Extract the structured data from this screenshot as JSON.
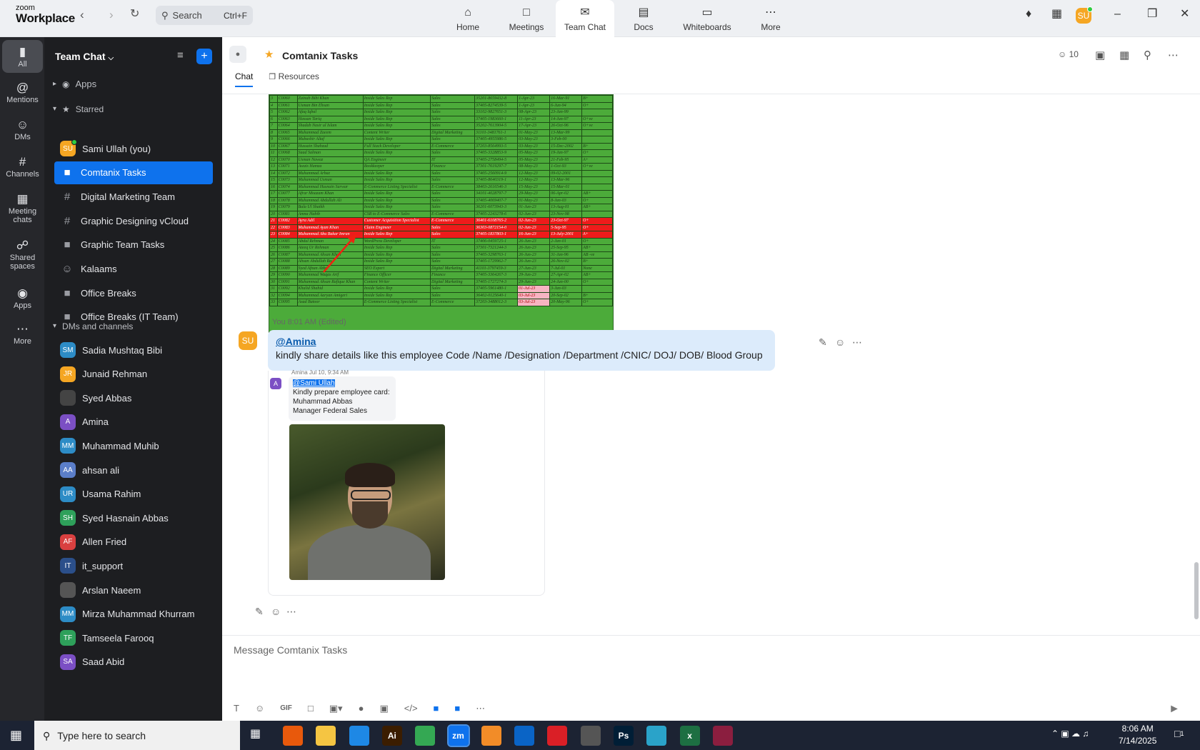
{
  "app": {
    "brand_small": "zoom",
    "brand": "Workplace",
    "search_placeholder": "Search",
    "search_shortcut": "Ctrl+F",
    "user_initials": "SU",
    "tabs": [
      {
        "label": "Home",
        "icon": "home-icon"
      },
      {
        "label": "Meetings",
        "icon": "video-icon"
      },
      {
        "label": "Team Chat",
        "icon": "chat-icon"
      },
      {
        "label": "Docs",
        "icon": "docs-icon"
      },
      {
        "label": "Whiteboards",
        "icon": "whiteboard-icon"
      },
      {
        "label": "More",
        "icon": "more-icon"
      }
    ]
  },
  "rail": [
    {
      "label": "All",
      "icon": "chat-bubble-icon"
    },
    {
      "label": "Mentions",
      "icon": "at-icon"
    },
    {
      "label": "DMs",
      "icon": "people-icon"
    },
    {
      "label": "Channels",
      "icon": "hash-icon"
    },
    {
      "label": "Meeting chats",
      "icon": "calendar-icon"
    },
    {
      "label": "Shared spaces",
      "icon": "shared-icon"
    },
    {
      "label": "Apps",
      "icon": "apps-icon"
    },
    {
      "label": "More",
      "icon": "more-icon"
    }
  ],
  "sidebar": {
    "title": "Team Chat",
    "apps_label": "Apps",
    "starred_label": "Starred",
    "dms_label": "DMs and channels",
    "starred": [
      {
        "name": "Sami Ullah (you)",
        "initials": "SU",
        "color": "#f5a623",
        "kind": "avatar",
        "status": "#2ecc40"
      },
      {
        "name": "Comtanix Tasks",
        "kind": "lock",
        "active": true
      },
      {
        "name": "Digital Marketing Team",
        "kind": "hash"
      },
      {
        "name": "Graphic Designing vCloud",
        "kind": "hash"
      },
      {
        "name": "Graphic Team Tasks",
        "kind": "lock"
      },
      {
        "name": "Kalaams",
        "kind": "group"
      },
      {
        "name": "Office Breaks",
        "kind": "lock"
      },
      {
        "name": "Office Breaks (IT Team)",
        "kind": "lock"
      }
    ],
    "dms": [
      {
        "name": "Sadia Mushtaq Bibi",
        "initials": "SM",
        "color": "#2d8cc6",
        "status": "#2ecc40"
      },
      {
        "name": "Junaid Rehman",
        "initials": "JR",
        "color": "#f5a623",
        "status": "#2ecc40"
      },
      {
        "name": "Syed Abbas",
        "initials": "",
        "color": "#444",
        "status": "#2ecc40"
      },
      {
        "name": "Amina",
        "initials": "A",
        "color": "#7b4fc4",
        "status": "#999"
      },
      {
        "name": "Muhammad Muhib",
        "initials": "MM",
        "color": "#2d8cc6",
        "status": "#2ecc40"
      },
      {
        "name": "ahsan ali",
        "initials": "AA",
        "color": "#5b7ec9",
        "status": "#2ecc40"
      },
      {
        "name": "Usama Rahim",
        "initials": "UR",
        "color": "#2d8cc6",
        "status": "#2ecc40"
      },
      {
        "name": "Syed Hasnain Abbas",
        "initials": "SH",
        "color": "#2ea05a",
        "status": "#2ecc40"
      },
      {
        "name": "Allen Fried",
        "initials": "AF",
        "color": "#d94040",
        "status": "#2ecc40"
      },
      {
        "name": "it_support",
        "initials": "IT",
        "color": "#2b4f8a",
        "status": "#999"
      },
      {
        "name": "Arslan Naeem",
        "initials": "",
        "color": "#555",
        "status": "#2ecc40"
      },
      {
        "name": "Mirza Muhammad Khurram",
        "initials": "MM",
        "color": "#2d8cc6",
        "status": "#999"
      },
      {
        "name": "Tamseela Farooq",
        "initials": "TF",
        "color": "#2ea05a",
        "status": "#999"
      },
      {
        "name": "Saad Abid",
        "initials": "SA",
        "color": "#7b4fc4",
        "status": "#999"
      }
    ]
  },
  "channel": {
    "title": "Comtanix Tasks",
    "members": "10",
    "tabs": [
      "Chat",
      "Resources"
    ]
  },
  "sheet_rows": [
    [
      "3",
      "C0060",
      "Zainab Bibi Khan",
      "Inside Sales Rep",
      "Sales",
      "35201-8659432-8",
      "1-Apr-23",
      "16-Mar-91",
      "B+"
    ],
    [
      "4",
      "C0061",
      "Usman Bin Ehsan",
      "Inside Sales Rep",
      "Sales",
      "37405-8274539-5",
      "1-Apr-23",
      "6-Jun-94",
      "O+"
    ],
    [
      "5",
      "C0062",
      "Afaq Iqbal",
      "Inside Sales Rep",
      "Sales",
      "33102-9827651-3",
      "08-Apr-23",
      "23-Jan-99",
      ""
    ],
    [
      "6",
      "C0063",
      "Hassan Tariq",
      "Inside Sales Rep",
      "Sales",
      "37405-1983660-1",
      "11-Apr-23",
      "14-Jun-97",
      "O+ve"
    ],
    [
      "7",
      "C0064",
      "Shadab Nasir ul Islam",
      "Inside Sales Rep",
      "Sales",
      "35202-7613904-5",
      "17-Apr-23",
      "26-Oct-96",
      "O+ve"
    ],
    [
      "8",
      "C0065",
      "Muhammad Zaeem",
      "Content Writer",
      "Digital Marketing",
      "31101-3481761-1",
      "01-May-23",
      "13-Mar-99",
      ""
    ],
    [
      "9",
      "C0066",
      "Mubashir Altaf",
      "Inside Sales Rep",
      "Sales",
      "37405-4955986-5",
      "03-May-23",
      "3-Feb-00",
      ""
    ],
    [
      "10",
      "C0067",
      "Hussain Shahzad",
      "Full Stack Developer",
      "E-Commerce",
      "37203-8564993-5",
      "03-May-23",
      "15-Dec-2002",
      "B+"
    ],
    [
      "11",
      "C0068",
      "Saad Salman",
      "Inside Sales Rep",
      "Sales",
      "37405-3328853-9",
      "05-May-23",
      "19-Jan-97",
      "O+"
    ],
    [
      "12",
      "C0070",
      "Usman Nawaz",
      "QA Engineer",
      "IT",
      "37405-2758494-5",
      "05-May-23",
      "21-Feb-95",
      "A+"
    ],
    [
      "13",
      "C0071",
      "Awais Hamza",
      "Bookkeeper",
      "Finance",
      "37301-7619297-7",
      "08-May-23",
      "1-Oct-93",
      "O+ve"
    ],
    [
      "14",
      "C0072",
      "Muhammad Arbaz",
      "Inside Sales Rep",
      "Sales",
      "37405-2560914-9",
      "12-May-23",
      "09-02-2001",
      ""
    ],
    [
      "15",
      "C0073",
      "Muhammad Usman",
      "Inside Sales Rep",
      "Sales",
      "37405-8640319-1",
      "12-May-23",
      "13-Mar-96",
      ""
    ],
    [
      "16",
      "C0074",
      "Muhammad Husnain Sarwar",
      "E-Commerce Listing Specialist",
      "E-Commerce",
      "38403-2616546-3",
      "15-May-23",
      "15-Mar-01",
      ""
    ],
    [
      "17",
      "C0077",
      "Afrar Moazam Khan",
      "Inside Sales Rep",
      "Sales",
      "34101-4028797-7",
      "29-May-23",
      "06-Apr-02",
      "AB+"
    ],
    [
      "18",
      "C0078",
      "Muhammad Abdullah Ali",
      "Inside Sales Rep",
      "Sales",
      "37405-4069407-7",
      "01-May-23",
      "8-Jan-03",
      "O+"
    ],
    [
      "19",
      "C0079",
      "Bala Ul Shaikh",
      "Inside Sales Rep",
      "Sales",
      "36201-6073943-3",
      "01-Jun-23",
      "13-Aug-01",
      "AB+"
    ],
    [
      "20",
      "C0081",
      "Amna Habib",
      "CSR to E-Commerce Sales",
      "E-Commerce",
      "37405-2243278-6",
      "02-Jun-23",
      "23-Nov-98",
      ""
    ],
    [
      "21",
      "C0082",
      "Ayra Adil",
      "Customer Acquisition Specialist",
      "E-Commerce",
      "36401-6108765-2",
      "02-Jun-23",
      "23-Oct-97",
      "O+",
      "red"
    ],
    [
      "22",
      "C0083",
      "Muhammad Ayan Khan",
      "Claim Engineer",
      "Sales",
      "36303-0872154-0",
      "02-Jun-23",
      "5-Sep-95",
      "O+",
      "red"
    ],
    [
      "23",
      "C0084",
      "Muhammad Abu Bakar Imran",
      "Inside Sales Rep",
      "Sales",
      "37405-1837803-1",
      "16-Jun-23",
      "13-July-2001",
      "A+",
      "red"
    ],
    [
      "24",
      "C0085",
      "Abdul Rehman",
      "WordPress Developer",
      "IT",
      "37406-0459725-1",
      "26-Jun-23",
      "2-Jan-01",
      "O+"
    ],
    [
      "25",
      "C0086",
      "Ateeq Ur Rehman",
      "Inside Sales Rep",
      "Sales",
      "37301-7321244-3",
      "26-Jun-23",
      "25-Sep-95",
      "AB+"
    ],
    [
      "26",
      "C0087",
      "Muhammad Ahsan Khan",
      "Inside Sales Rep",
      "Sales",
      "37405-3298763-1",
      "26-Jun-23",
      "31-Jan-96",
      "AB -ve"
    ],
    [
      "27",
      "C0088",
      "Ahsan Abdullah Ra",
      "Inside Sales Rep",
      "Sales",
      "37405-1729962-7",
      "26-Jun-23",
      "26-Nov-02",
      "B+"
    ],
    [
      "28",
      "C0089",
      "Syed Afnan Abba",
      "SEO Expert",
      "Digital Marketing",
      "41101-3797459-3",
      "27-Jun-23",
      "7-Jul-01",
      "None"
    ],
    [
      "29",
      "C0090",
      "Muhammad Waqas Arif",
      "Finance Officer",
      "Finance",
      "37405-3364267-3",
      "29-Jun-23",
      "27-Apr-02",
      "AB+"
    ],
    [
      "30",
      "C0091",
      "Muhammad Ahsan Rafique Khan",
      "Content Writer",
      "Digital Marketing",
      "37405-1727274-3",
      "29-Jun-23",
      "24-Jun-00",
      "O+"
    ],
    [
      "31",
      "C0092",
      "Khalid Shahid",
      "Inside Sales Rep",
      "Sales",
      "37405-5961480-1",
      "01-Jul-23",
      "3-Jan-03",
      "",
      "pinkdate"
    ],
    [
      "32",
      "C0094",
      "Muhammad Aaryan Amigeri",
      "Inside Sales Rep",
      "Sales",
      "36402-0125640-1",
      "03-Jul-23",
      "20-Sep-02",
      "B+",
      "pinkdate"
    ],
    [
      "33",
      "C0095",
      "Asad Batoor",
      "E-Commerce Listing Specialist",
      "E-Commerce",
      "37203-3488012-3",
      "03-Jul-23",
      "20-May-96",
      "O+",
      "pinkdate"
    ]
  ],
  "messages": {
    "sender": "You",
    "time": "8:01 AM (Edited)",
    "avatar": "SU",
    "mention": "@Amina",
    "text": "kindly share details like this  employee Code /Name /Designation /Department /CNIC/ DOJ/ DOB/ Blood Group",
    "quote": {
      "author": "Amina",
      "date": "Jul 10, 9:34 AM",
      "avatar": "A",
      "mention": "@Sami Ullah",
      "lines": [
        "Kindly prepare employee card:",
        "Muhammad Abbas",
        "Manager Federal Sales"
      ]
    }
  },
  "compose": {
    "placeholder": "Message Comtanix Tasks"
  },
  "taskbar": {
    "search_placeholder": "Type here to search",
    "time": "8:06 AM",
    "date": "7/14/2025",
    "notifications": "1",
    "apps": [
      {
        "name": "firefox",
        "label": "",
        "color": "#e8590c"
      },
      {
        "name": "explorer",
        "label": "",
        "color": "#f5c542"
      },
      {
        "name": "vscode",
        "label": "",
        "color": "#1e88e5"
      },
      {
        "name": "illustrator",
        "label": "Ai",
        "color": "#3b1d00"
      },
      {
        "name": "chrome",
        "label": "",
        "color": "#34a853"
      },
      {
        "name": "zoom",
        "label": "zm",
        "color": "#0e72ed"
      },
      {
        "name": "app7",
        "label": "",
        "color": "#f28c28"
      },
      {
        "name": "outlook",
        "label": "",
        "color": "#0a64c6"
      },
      {
        "name": "cc",
        "label": "",
        "color": "#da1f26"
      },
      {
        "name": "pen",
        "label": "",
        "color": "#555"
      },
      {
        "name": "photoshop",
        "label": "Ps",
        "color": "#001e36"
      },
      {
        "name": "app12",
        "label": "",
        "color": "#2aa3c9"
      },
      {
        "name": "excel",
        "label": "x",
        "color": "#1d6f42"
      },
      {
        "name": "winrar",
        "label": "",
        "color": "#8b1e3f"
      }
    ]
  }
}
